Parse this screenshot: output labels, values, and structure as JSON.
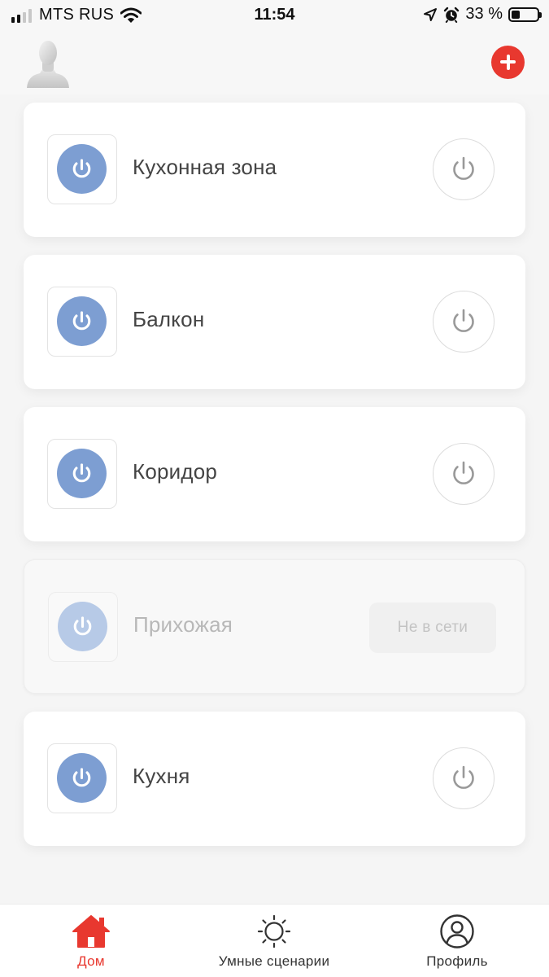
{
  "status_bar": {
    "carrier": "MTS RUS",
    "time": "11:54",
    "battery_text": "33 %",
    "battery_level": 0.33,
    "signal_bars_active": 2,
    "icons": [
      "signal-icon",
      "wifi-icon",
      "location-arrow-icon",
      "alarm-icon",
      "battery-icon"
    ]
  },
  "header": {
    "avatar_icon": "user-avatar-icon",
    "add_icon": "plus-icon",
    "accent_color": "#e8382f"
  },
  "devices": [
    {
      "name": "Кухонная зона",
      "online": true,
      "icon": "power-icon"
    },
    {
      "name": "Балкон",
      "online": true,
      "icon": "power-icon"
    },
    {
      "name": "Коридор",
      "online": true,
      "icon": "power-icon"
    },
    {
      "name": "Прихожая",
      "online": false,
      "status": "Не в сети",
      "icon": "power-icon"
    },
    {
      "name": "Кухня",
      "online": true,
      "icon": "power-icon"
    }
  ],
  "tabbar": {
    "active": "home",
    "items": [
      {
        "label": "Дом",
        "icon": "home-icon"
      },
      {
        "label": "Умные сценарии",
        "icon": "sun-icon"
      },
      {
        "label": "Профиль",
        "icon": "profile-icon"
      }
    ]
  },
  "colors": {
    "device_icon_bg": "#7d9ed2",
    "device_icon_bg_offline": "#b7cae7",
    "active_tab": "#e8382f"
  }
}
